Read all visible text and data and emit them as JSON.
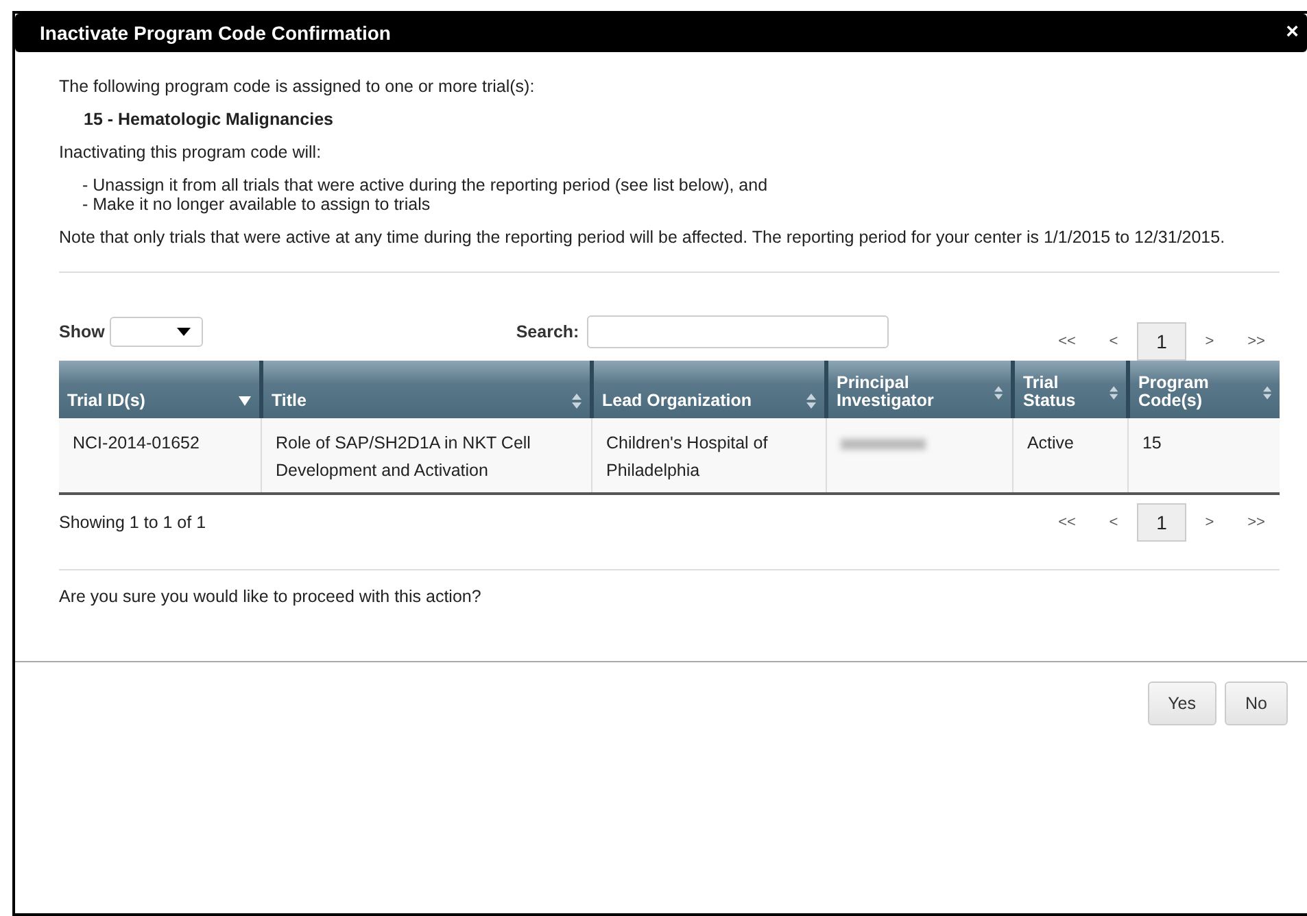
{
  "dialog": {
    "title": "Inactivate Program Code Confirmation",
    "close": "×"
  },
  "intro": "The following program code is assigned to one or more trial(s):",
  "program_code": "15 - Hematologic Malignancies",
  "will_label": "Inactivating this program code will:",
  "effects": [
    "- Unassign it from all trials that were active during the reporting period (see list below), and",
    "- Make it no longer available to assign to trials"
  ],
  "note": "Note that only trials that were active at any time during the reporting period will be affected. The reporting period for your center is 1/1/2015 to 12/31/2015.",
  "show_label": "Show",
  "search_label": "Search:",
  "pager_top": [
    {
      "label": "<<",
      "selected": false
    },
    {
      "label": "<",
      "selected": false
    },
    {
      "label": "1",
      "selected": true
    },
    {
      "label": ">",
      "selected": false
    },
    {
      "label": ">>",
      "selected": false
    }
  ],
  "table": {
    "columns": [
      {
        "label": "Trial ID(s)",
        "sorted": true
      },
      {
        "label": "Title",
        "sorted": false
      },
      {
        "label": "Lead Organization",
        "sorted": false
      },
      {
        "label": "Principal Investigator",
        "sorted": false
      },
      {
        "label": "Trial Status",
        "sorted": false
      },
      {
        "label": "Program Code(s)",
        "sorted": false
      }
    ],
    "rows": [
      {
        "cells": [
          "NCI-2014-01652",
          "Role of SAP/SH2D1A in NKT Cell Development and Activation",
          "Children's Hospital of Philadelphia",
          null,
          "Active",
          "15"
        ]
      }
    ]
  },
  "info": "Showing 1 to 1 of 1",
  "pager_bottom": [
    {
      "label": "<<",
      "selected": false
    },
    {
      "label": "<",
      "selected": false
    },
    {
      "label": "1",
      "selected": true
    },
    {
      "label": ">",
      "selected": false
    },
    {
      "label": ">>",
      "selected": false
    }
  ],
  "question": "Are you sure you would like to proceed with this action?",
  "buttons": [
    "Yes",
    "No"
  ]
}
